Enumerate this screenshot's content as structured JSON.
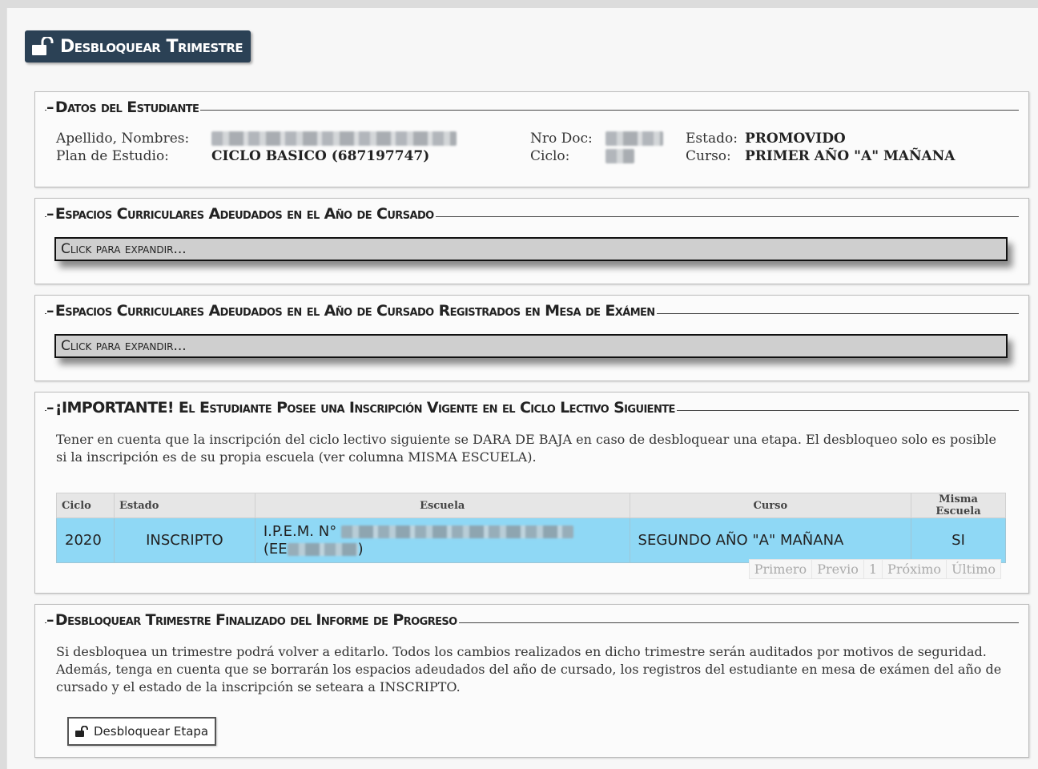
{
  "title": "Desbloquear Trimestre",
  "student": {
    "legend": "Datos del Estudiante",
    "name_label": "Apellido, Nombres:",
    "plan_label": "Plan de Estudio:",
    "plan_value": "CICLO BASICO (687197747)",
    "doc_label": "Nro Doc:",
    "ciclo_label": "Ciclo:",
    "estado_label": "Estado:",
    "estado_value": "PROMOVIDO",
    "curso_label": "Curso:",
    "curso_value": "PRIMER AÑO \"A\" MAÑANA"
  },
  "owed": {
    "legend": "Espacios Curriculares Adeudados en el Año de Cursado",
    "expander": "Click para expandir..."
  },
  "owed_exam": {
    "legend": "Espacios Curriculares Adeudados en el Año de Cursado Registrados en Mesa de Exámen",
    "expander": "Click para expandir..."
  },
  "important": {
    "legend": "¡IMPORTANTE! El Estudiante Posee una Inscripción Vigente en el Ciclo Lectivo Siguiente",
    "text": "Tener en cuenta que la inscripción del ciclo lectivo siguiente se DARA DE BAJA en caso de desbloquear una etapa. El desbloqueo solo es posible si la inscripción es de su propia escuela (ver columna MISMA ESCUELA).",
    "columns": [
      "Ciclo",
      "Estado",
      "Escuela",
      "Curso",
      "Misma Escuela"
    ],
    "rows": [
      {
        "ciclo": "2020",
        "estado": "INSCRIPTO",
        "escuela_line1": "I.P.E.M. N°",
        "escuela_line2_prefix": "(EE",
        "escuela_line2_suffix": ")",
        "curso": "SEGUNDO AÑO \"A\" MAÑANA",
        "misma": "SI"
      }
    ],
    "pager": [
      "Primero",
      "Previo",
      "1",
      "Próximo",
      "Último"
    ]
  },
  "unlock": {
    "legend": "Desbloquear Trimestre Finalizado del Informe de Progreso",
    "text": "Si desbloquea un trimestre podrá volver a editarlo. Todos los cambios realizados en dicho trimestre serán auditados por motivos de seguridad. Además, tenga en cuenta que se borrarán los espacios adeudados del año de cursado, los registros del estudiante en mesa de exámen del año de cursado y el estado de la inscripción se seteara a INSCRIPTO.",
    "button": "Desbloquear Etapa"
  },
  "colors": {
    "title_bg": "#2b4155",
    "row_highlight": "#8fd8f5",
    "expander_bg": "#cfcfcf"
  },
  "icons": [
    "unlock-icon"
  ]
}
